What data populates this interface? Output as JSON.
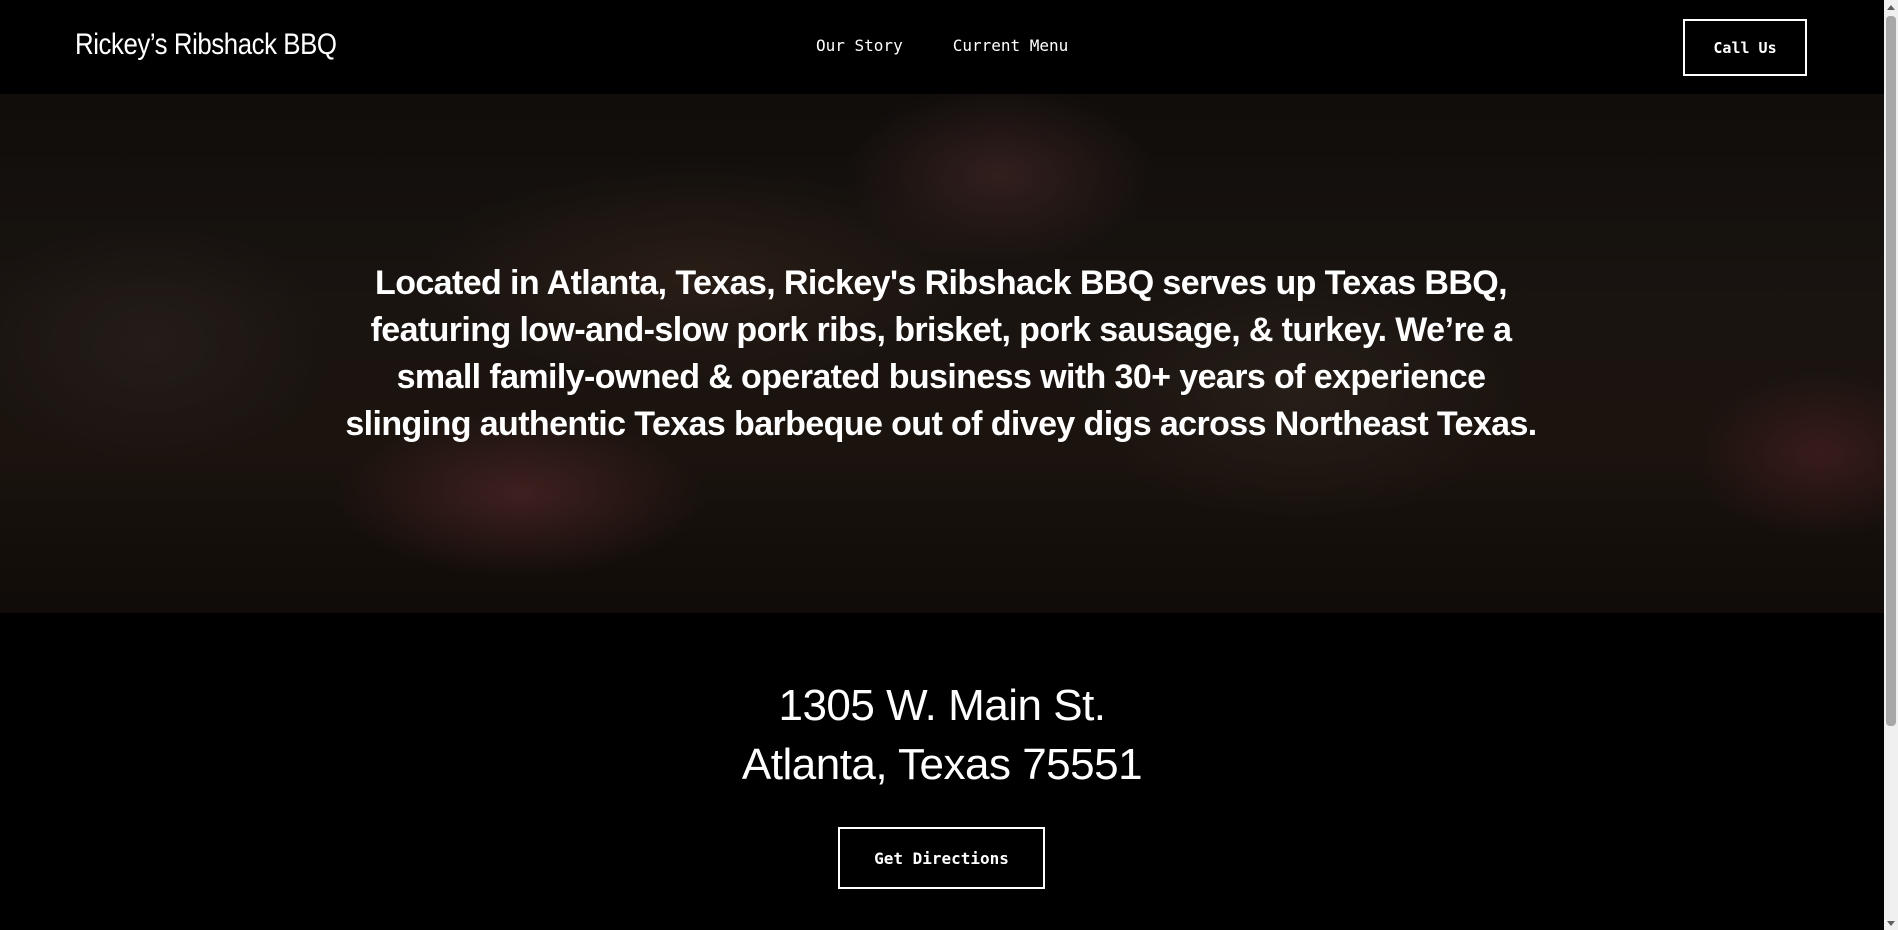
{
  "header": {
    "brand": "Rickey’s Ribshack BBQ",
    "nav": [
      "Our Story",
      "Current Menu"
    ],
    "call_button": "Call Us"
  },
  "hero": {
    "text": "Located in Atlanta, Texas, Rickey's Ribshack BBQ serves up Texas BBQ, featuring low-and-slow pork ribs, brisket, pork sausage, & turkey. We’re a small family-owned & operated business with 30+ years of experience slinging authentic Texas barbeque out of divey digs across Northeast Texas."
  },
  "location": {
    "address_line1": "1305 W. Main St.",
    "address_line2": "Atlanta, Texas 75551",
    "directions_button": "Get Directions"
  }
}
